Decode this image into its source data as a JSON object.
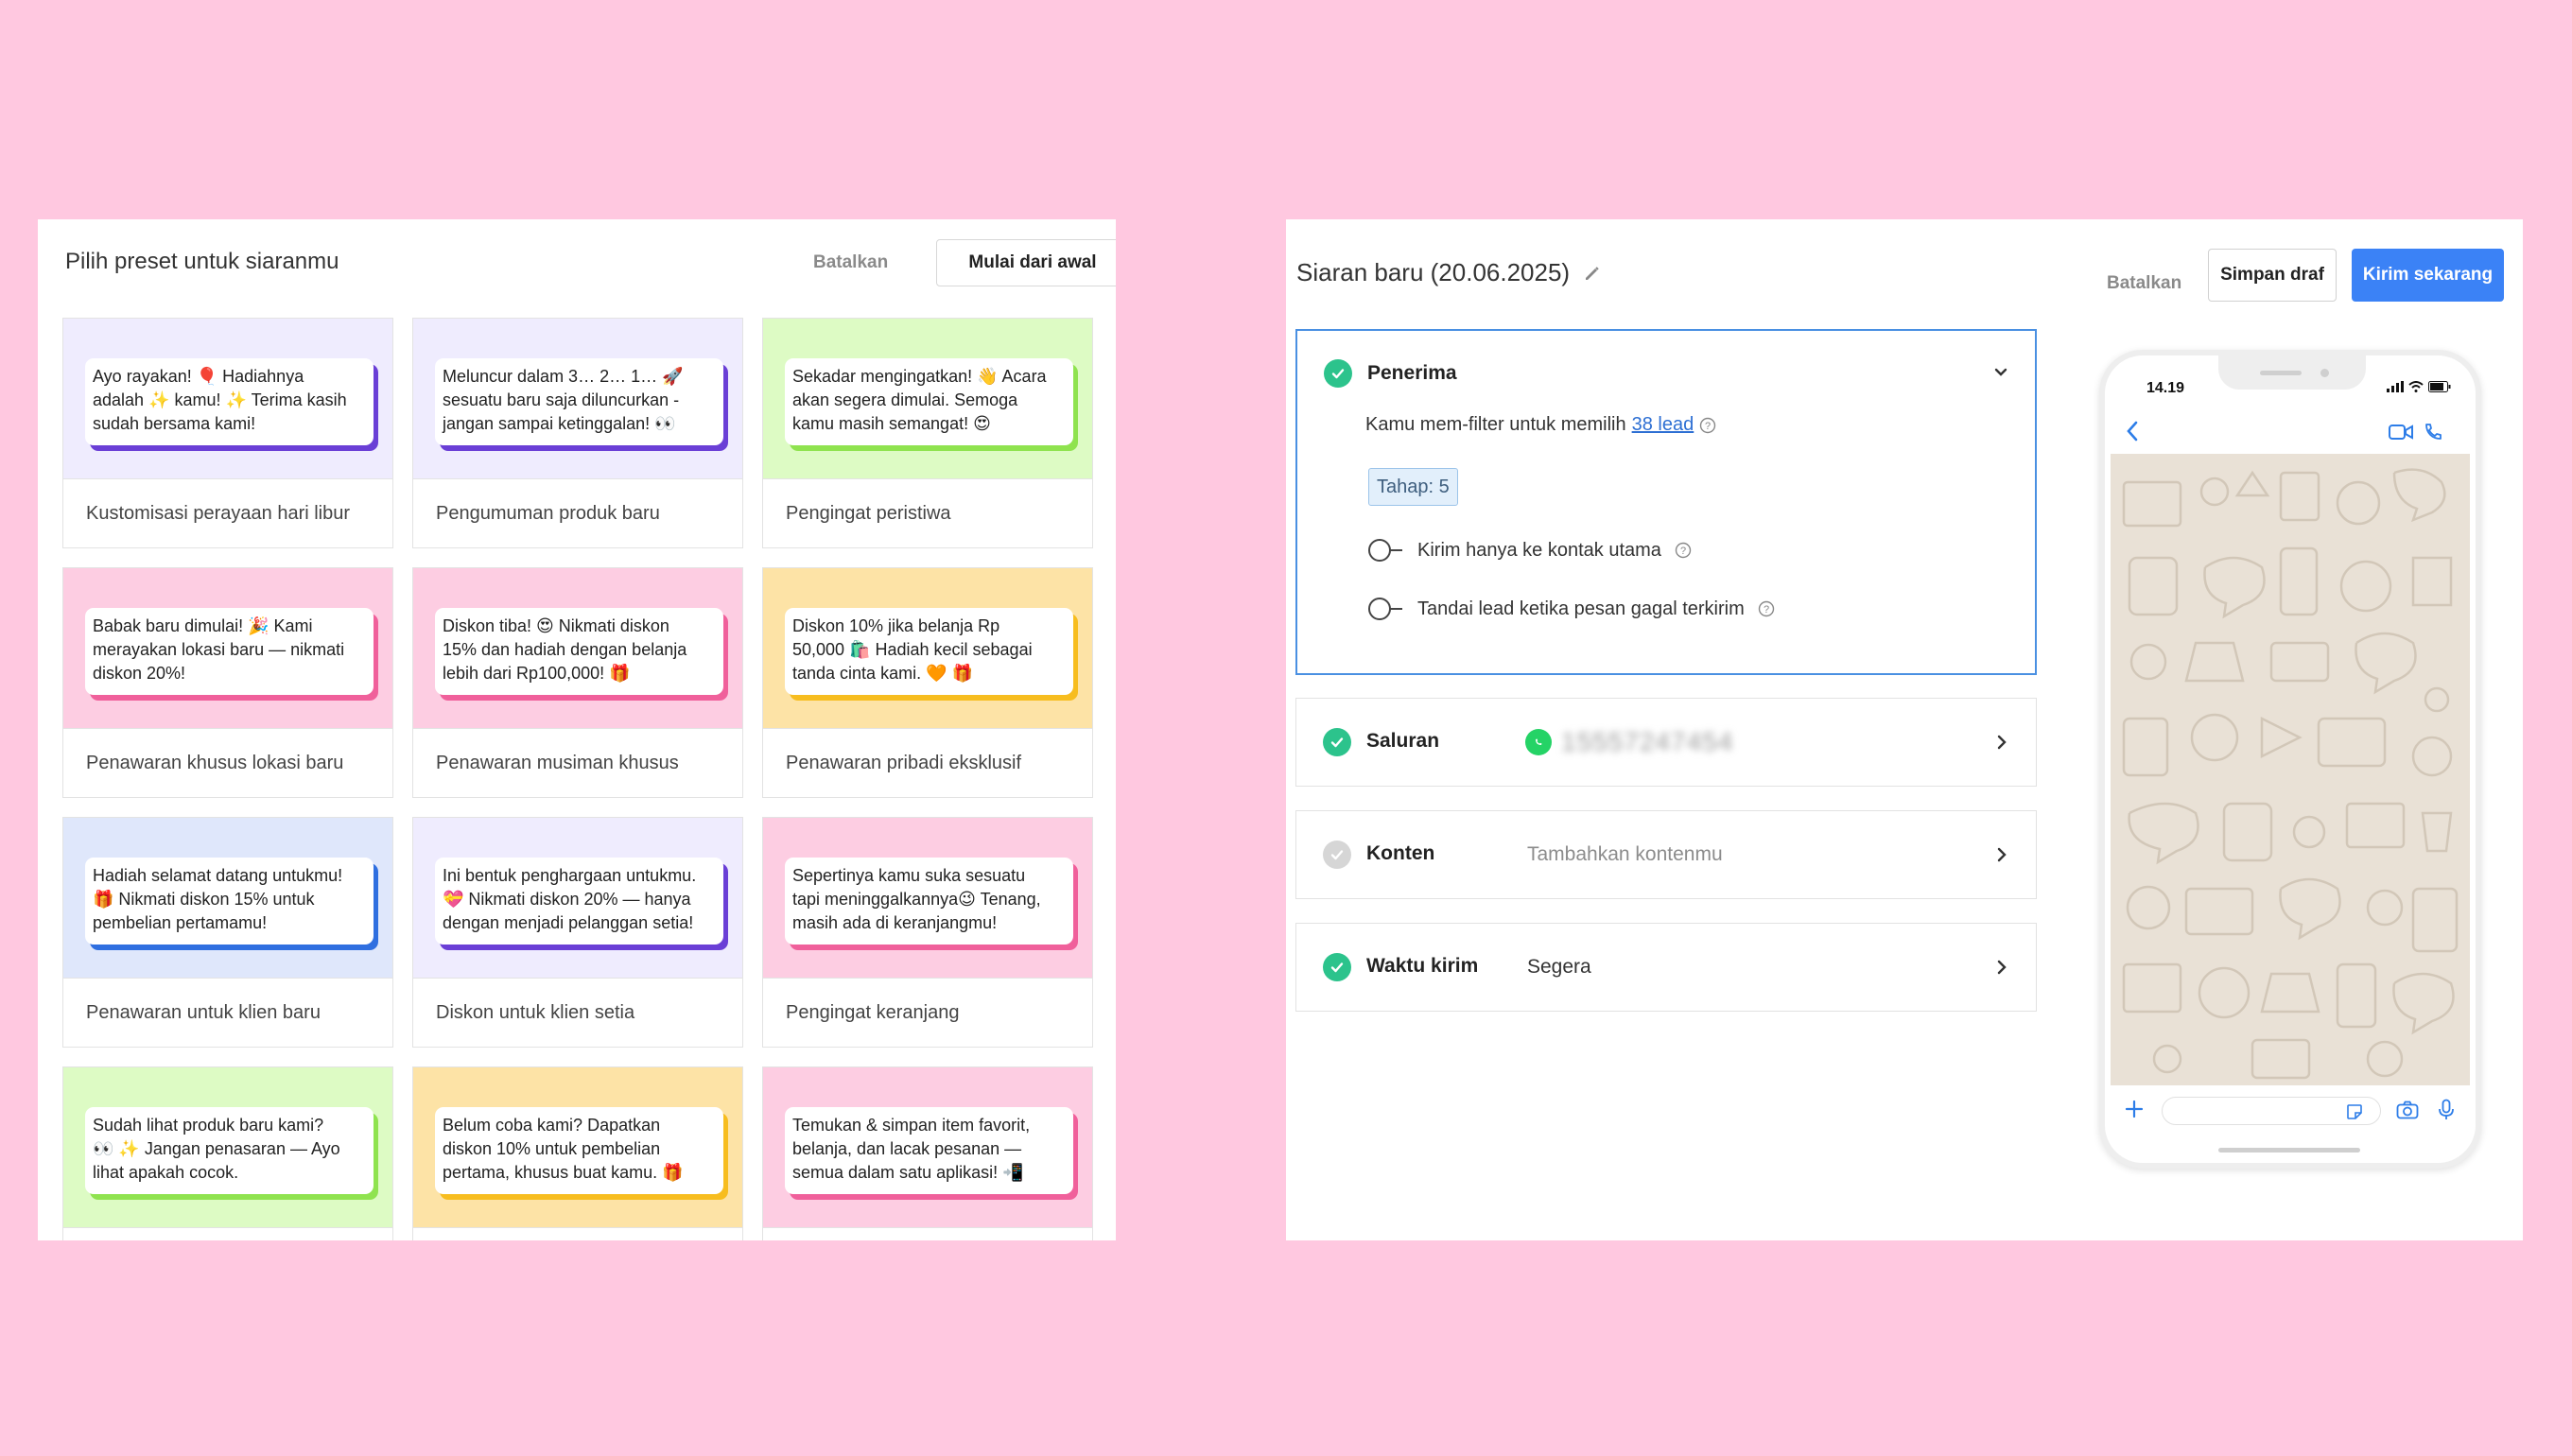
{
  "colors": {
    "background": "#ffc8e0",
    "accent_blue": "#3b82f6",
    "success_green": "#2cc38c",
    "whatsapp_green": "#25d366"
  },
  "preset_panel": {
    "title": "Pilih preset untuk siaranmu",
    "cancel_label": "Batalkan",
    "start_blank_label": "Mulai dari awal",
    "cards": [
      {
        "preview_bg": "#efecfe",
        "accent": "#6a3fd6",
        "message": "Ayo rayakan! 🎈 Hadiahnya\nadalah ✨ kamu! ✨ Terima kasih\nsudah bersama kami!",
        "label": "Kustomisasi perayaan hari libur"
      },
      {
        "preview_bg": "#efecfe",
        "accent": "#6a3fd6",
        "message": "Meluncur dalam 3… 2… 1… 🚀\nsesuatu baru saja diluncurkan -\njangan sampai ketinggalan! 👀",
        "label": "Pengumuman produk baru"
      },
      {
        "preview_bg": "#ddfbc4",
        "accent": "#8fe34f",
        "message": "Sekadar mengingatkan! 👋 Acara\nakan segera dimulai. Semoga\nkamu masih semangat! 😍",
        "label": "Pengingat peristiwa"
      },
      {
        "preview_bg": "#fdcde2",
        "accent": "#f0609b",
        "message": "Babak baru dimulai! 🎉 Kami\nmerayakan lokasi baru — nikmati\ndiskon 20%!",
        "label": "Penawaran khusus lokasi baru"
      },
      {
        "preview_bg": "#fdcde2",
        "accent": "#f0609b",
        "message": "Diskon tiba! 😍 Nikmati diskon\n15% dan hadiah dengan belanja\nlebih dari Rp100,000! 🎁",
        "label": "Penawaran musiman khusus"
      },
      {
        "preview_bg": "#fde3a6",
        "accent": "#f7bd1f",
        "message": "Diskon 10% jika belanja Rp\n50,000 🛍️ Hadiah kecil sebagai\ntanda cinta kami. 🧡 🎁",
        "label": "Penawaran pribadi eksklusif"
      },
      {
        "preview_bg": "#dfe7fb",
        "accent": "#2f6fe0",
        "message": "Hadiah selamat datang untukmu!\n🎁 Nikmati diskon 15% untuk\npembelian pertamamu!",
        "label": "Penawaran untuk klien baru"
      },
      {
        "preview_bg": "#efecfe",
        "accent": "#6a3fd6",
        "message": "Ini bentuk penghargaan untukmu.\n💝 Nikmati diskon 20% — hanya\ndengan menjadi pelanggan setia!",
        "label": "Diskon untuk klien setia"
      },
      {
        "preview_bg": "#fdcde2",
        "accent": "#f0609b",
        "message": "Sepertinya kamu suka sesuatu\ntapi meninggalkannya😉 Tenang,\nmasih ada di keranjangmu!",
        "label": "Pengingat keranjang"
      },
      {
        "preview_bg": "#ddfbc4",
        "accent": "#8fe34f",
        "message": "Sudah lihat produk baru kami?\n👀 ✨ Jangan penasaran — Ayo\nlihat apakah cocok.",
        "label": ""
      },
      {
        "preview_bg": "#fde3a6",
        "accent": "#f7bd1f",
        "message": "Belum coba kami? Dapatkan\ndiskon 10% untuk pembelian\npertama, khusus buat kamu. 🎁",
        "label": ""
      },
      {
        "preview_bg": "#fdcde2",
        "accent": "#f0609b",
        "message": "Temukan & simpan item favorit,\nbelanja, dan lacak pesanan —\nsemua dalam satu aplikasi! 📲",
        "label": ""
      }
    ]
  },
  "broadcast_panel": {
    "title": "Siaran baru (20.06.2025)",
    "edit_icon": "pencil-icon",
    "cancel_label": "Batalkan",
    "draft_label": "Simpan draf",
    "send_label": "Kirim sekarang",
    "recipients": {
      "title": "Penerima",
      "filter_prefix": "Kamu mem-filter untuk memilih",
      "lead_link": "38 lead",
      "stage_chip": "Tahap: 5",
      "toggle_main_contact": "Kirim hanya ke kontak utama",
      "toggle_mark_failed": "Tandai lead ketika pesan gagal terkirim"
    },
    "channel": {
      "title": "Saluran",
      "value_obscured": "15557247454"
    },
    "content": {
      "title": "Konten",
      "placeholder": "Tambahkan kontenmu"
    },
    "send_time": {
      "title": "Waktu kirim",
      "value": "Segera"
    },
    "phone": {
      "time": "14.19"
    }
  }
}
